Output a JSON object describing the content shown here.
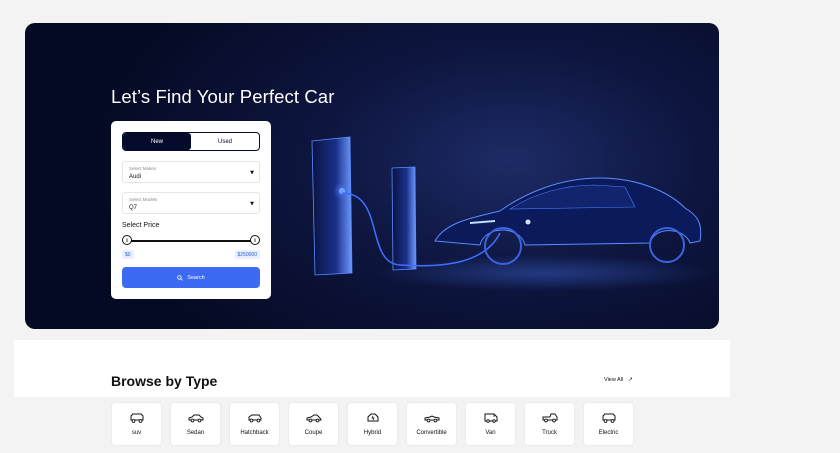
{
  "hero": {
    "title": "Let’s Find Your Perfect Car"
  },
  "search": {
    "tabs": [
      "New",
      "Used"
    ],
    "active_tab": "New",
    "make": {
      "label": "Select Makes",
      "value": "Audi"
    },
    "model": {
      "label": "Select Models",
      "value": "Q7"
    },
    "price_label": "Select Price",
    "price_min": "$0",
    "price_max": "$250000",
    "button_label": "Search"
  },
  "browse": {
    "title": "Browse by Type",
    "view_all": "View All",
    "types": [
      {
        "label": "suv",
        "icon": "suv-icon"
      },
      {
        "label": "Sedan",
        "icon": "sedan-icon"
      },
      {
        "label": "Hatchback",
        "icon": "hatchback-icon"
      },
      {
        "label": "Coupe",
        "icon": "coupe-icon"
      },
      {
        "label": "Hybrid",
        "icon": "hybrid-icon"
      },
      {
        "label": "Convertible",
        "icon": "convertible-icon"
      },
      {
        "label": "Van",
        "icon": "van-icon"
      },
      {
        "label": "Truck",
        "icon": "truck-icon"
      },
      {
        "label": "Electric",
        "icon": "electric-icon"
      }
    ]
  },
  "colors": {
    "hero_bg": "#050a24",
    "accent": "#3d6af2",
    "dark": "#050b2b"
  }
}
